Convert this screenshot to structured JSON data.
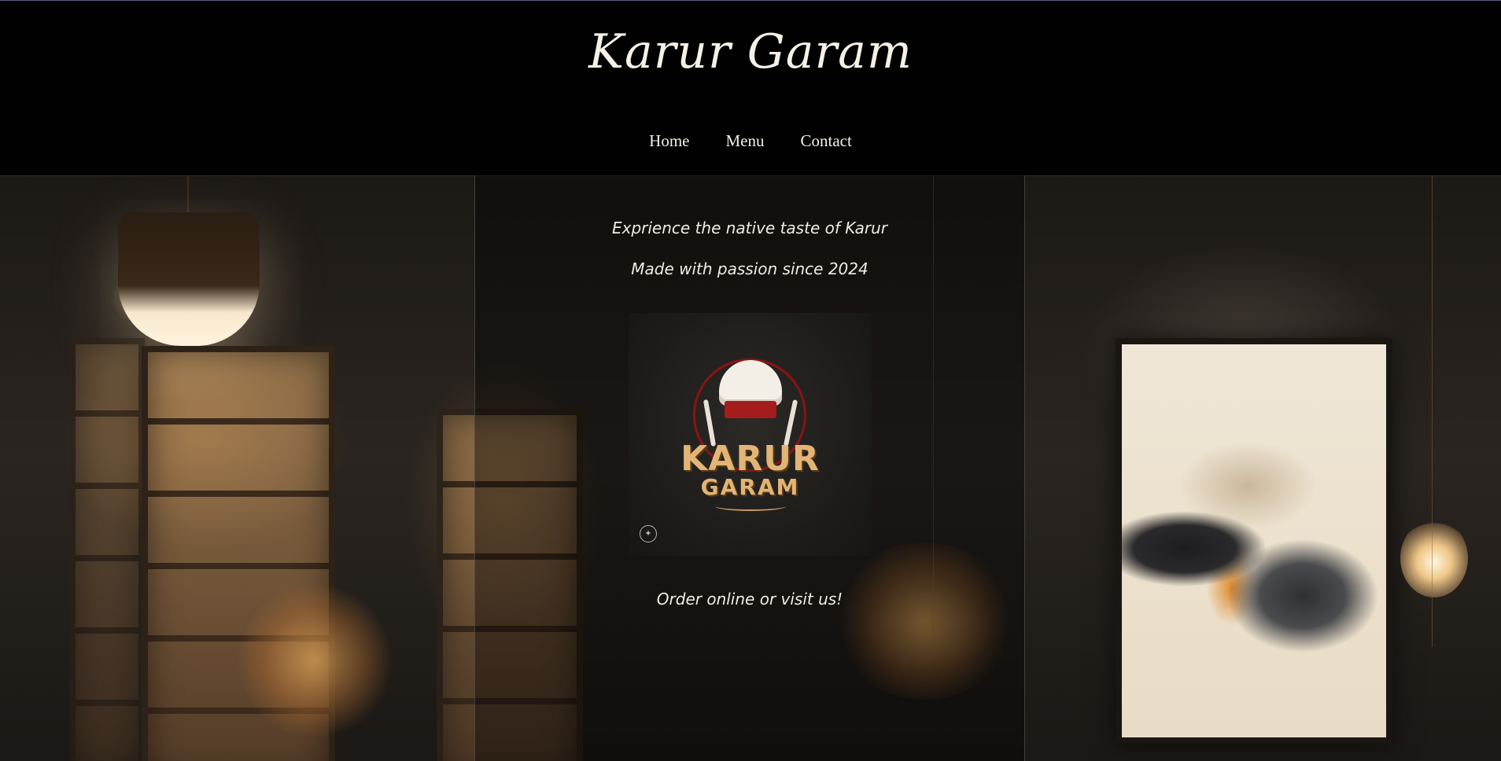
{
  "brand": {
    "title": "Karur Garam"
  },
  "nav": {
    "items": [
      {
        "label": "Home"
      },
      {
        "label": "Menu"
      },
      {
        "label": "Contact"
      }
    ]
  },
  "hero": {
    "tagline_1": "Exprience the native taste of Karur",
    "tagline_2": "Made with passion since 2024",
    "cta_text": "Order online or visit us!"
  },
  "logo": {
    "line_1": "KARUR",
    "line_2": "GARAM",
    "icon": "chef-hat-icon"
  },
  "colors": {
    "header_bg": "#000000",
    "text": "#f4f0e8",
    "logo_gold": "#e2b577",
    "logo_red": "#a51c1c"
  }
}
